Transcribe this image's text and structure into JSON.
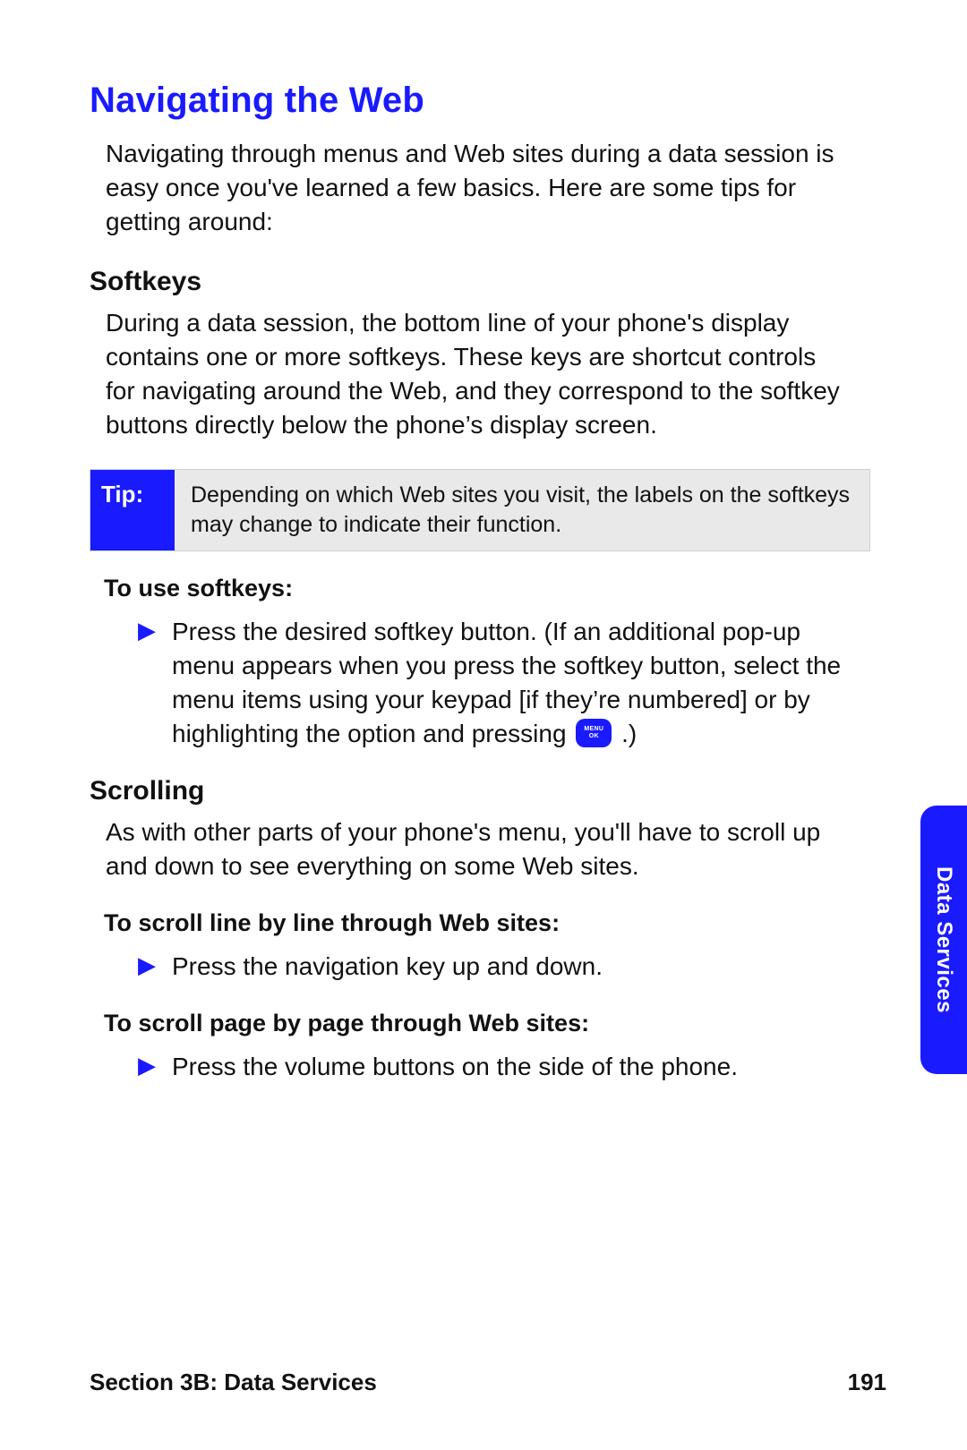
{
  "title": "Navigating the Web",
  "intro": "Navigating through menus and Web sites during a data session is easy once you've learned a few basics. Here are some tips for getting around:",
  "softkeys": {
    "heading": "Softkeys",
    "para": "During a data session, the bottom line of your phone's display contains one or more softkeys. These keys are shortcut controls for navigating around the Web, and they correspond to the softkey buttons directly below the phone’s display screen.",
    "tip_label": "Tip:",
    "tip_body": "Depending on which Web sites you visit, the labels on the softkeys may change to indicate their function.",
    "lead": "To use softkeys:",
    "bullet_pre": "Press the desired softkey button. (If an additional pop-up menu appears when you press the softkey button, select the menu items using your keypad [if they’re numbered] or by highlighting the option and pressing ",
    "key_top": "MENU",
    "key_bottom": "OK",
    "bullet_post": " .)"
  },
  "scrolling": {
    "heading": "Scrolling",
    "para": "As with other parts of your phone's menu, you'll have to scroll up and down to see everything on some Web sites.",
    "lead1": "To scroll line by line through Web sites:",
    "bullet1": "Press the navigation key up and down.",
    "lead2": "To scroll page by page through Web sites:",
    "bullet2": "Press the volume buttons on the side of the phone."
  },
  "sidetab": "Data Services",
  "footer_left": "Section 3B: Data Services",
  "footer_right": "191"
}
